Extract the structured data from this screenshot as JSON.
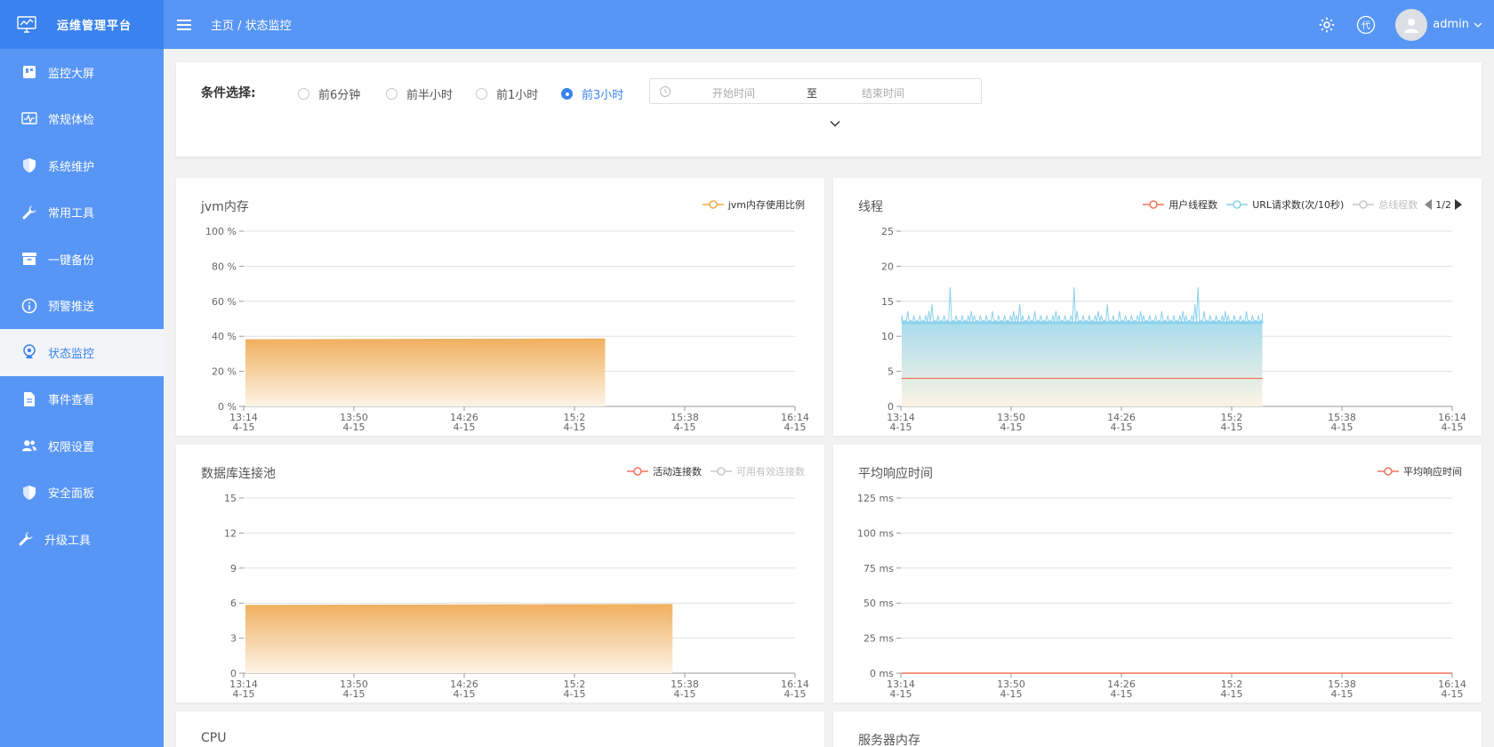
{
  "app": {
    "title": "运维管理平台"
  },
  "sidebar": {
    "items": [
      {
        "label": "监控大屏",
        "icon": "dashboard-icon",
        "active": false
      },
      {
        "label": "常规体检",
        "icon": "pulse-icon",
        "active": false
      },
      {
        "label": "系统维护",
        "icon": "shield-icon",
        "active": false
      },
      {
        "label": "常用工具",
        "icon": "wrench-icon",
        "active": false
      },
      {
        "label": "一键备份",
        "icon": "archive-icon",
        "active": false
      },
      {
        "label": "预警推送",
        "icon": "info-icon",
        "active": false
      },
      {
        "label": "状态监控",
        "icon": "webcam-icon",
        "active": true
      },
      {
        "label": "事件查看",
        "icon": "document-icon",
        "active": false
      },
      {
        "label": "权限设置",
        "icon": "users-icon",
        "active": false
      },
      {
        "label": "安全面板",
        "icon": "shield-icon",
        "active": false
      },
      {
        "label": "升级工具",
        "icon": "wrench-icon",
        "active": false
      }
    ]
  },
  "header": {
    "breadcrumb": "主页 / 状态监控",
    "code_badge": "代",
    "username": "admin"
  },
  "filter": {
    "label": "条件选择:",
    "options": [
      {
        "label": "前6分钟",
        "checked": false
      },
      {
        "label": "前半小时",
        "checked": false
      },
      {
        "label": "前1小时",
        "checked": false
      },
      {
        "label": "前3小时",
        "checked": true
      }
    ],
    "start_placeholder": "开始时间",
    "separator": "至",
    "end_placeholder": "结束时间"
  },
  "colors": {
    "primary": "#3a82f0",
    "header": "#5896f5",
    "orange": "#f5a84a",
    "red": "#f2735b",
    "cyan": "#8ad0ec",
    "grey": "#c8c8c8"
  },
  "charts": {
    "x_ticks": [
      "13:14",
      "13:50",
      "14:26",
      "15:2",
      "15:38",
      "16:14"
    ],
    "x_date": "4-15",
    "jvm": {
      "title": "jvm内存",
      "y_ticks": [
        "100 %",
        "80 %",
        "60 %",
        "40 %",
        "20 %",
        "0 %"
      ],
      "legend": [
        {
          "name": "jvm内存使用比例",
          "color": "#f5a84a",
          "enabled": true
        }
      ]
    },
    "threads": {
      "title": "线程",
      "y_ticks": [
        "25",
        "20",
        "15",
        "10",
        "5",
        "0"
      ],
      "legend": [
        {
          "name": "用户线程数",
          "color": "#f2735b",
          "enabled": true
        },
        {
          "name": "URL请求数(次/10秒)",
          "color": "#8ad0ec",
          "enabled": true
        },
        {
          "name": "总线程数",
          "color": "#c8c8c8",
          "enabled": false
        }
      ],
      "pager": "1/2"
    },
    "db": {
      "title": "数据库连接池",
      "y_ticks": [
        "15",
        "12",
        "9",
        "6",
        "3",
        "0"
      ],
      "legend": [
        {
          "name": "活动连接数",
          "color": "#f2735b",
          "enabled": true
        },
        {
          "name": "可用有效连接数",
          "color": "#c8c8c8",
          "enabled": false
        }
      ]
    },
    "resp": {
      "title": "平均响应时间",
      "y_ticks": [
        "125 ms",
        "100 ms",
        "75 ms",
        "50 ms",
        "25 ms",
        "0 ms"
      ],
      "legend": [
        {
          "name": "平均响应时间",
          "color": "#f2735b",
          "enabled": true
        }
      ]
    },
    "cpu": {
      "title": "CPU"
    },
    "server_mem": {
      "title": "服务器内存"
    }
  },
  "chart_data": [
    {
      "type": "area",
      "title": "jvm内存",
      "x_range": [
        "13:14",
        "16:14"
      ],
      "ylim": [
        0,
        100
      ],
      "series": [
        {
          "name": "jvm内存使用比例",
          "x_end": "15:12",
          "value": 38
        }
      ]
    },
    {
      "type": "area",
      "title": "线程",
      "x_range": [
        "13:14",
        "16:14"
      ],
      "ylim": [
        0,
        25
      ],
      "series": [
        {
          "name": "用户线程数",
          "x_end": "15:12",
          "value": 4
        },
        {
          "name": "URL请求数(次/10秒)",
          "x_end": "15:12",
          "value": 12,
          "spikes_to": 17
        }
      ]
    },
    {
      "type": "area",
      "title": "数据库连接池",
      "x_range": [
        "13:14",
        "16:14"
      ],
      "ylim": [
        0,
        15
      ],
      "series": [
        {
          "name": "活动连接数",
          "x_end": "15:34",
          "value": 5.8
        }
      ]
    },
    {
      "type": "line",
      "title": "平均响应时间",
      "x_range": [
        "13:14",
        "16:14"
      ],
      "ylim": [
        0,
        125
      ],
      "series": [
        {
          "name": "平均响应时间",
          "value": 0
        }
      ]
    }
  ]
}
